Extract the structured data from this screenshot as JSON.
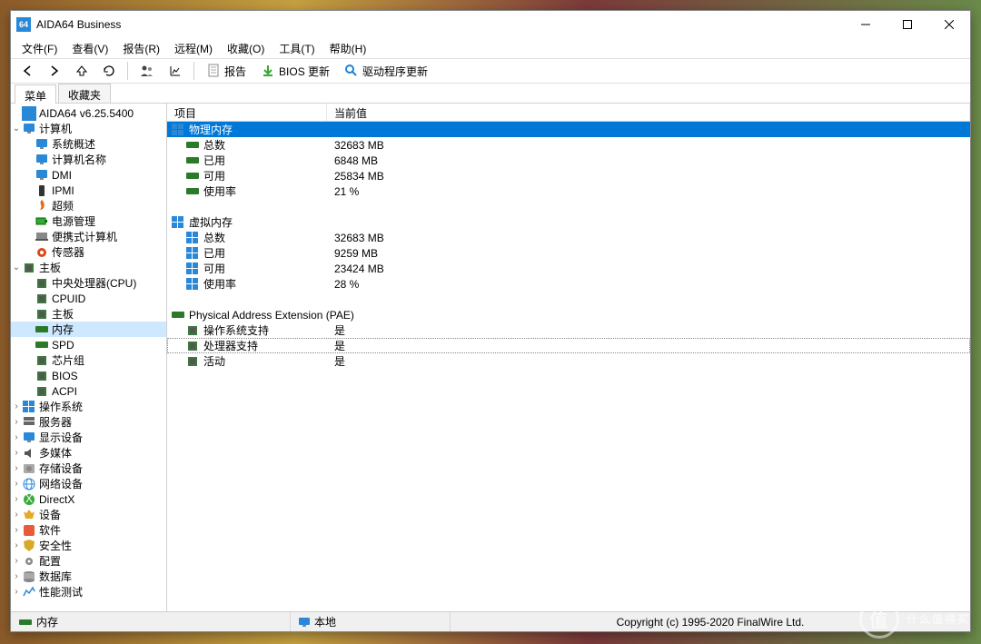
{
  "title": "AIDA64 Business",
  "menu": [
    "文件(F)",
    "查看(V)",
    "报告(R)",
    "远程(M)",
    "收藏(O)",
    "工具(T)",
    "帮助(H)"
  ],
  "toolbar": {
    "report": "报告",
    "bios": "BIOS 更新",
    "driver": "驱动程序更新"
  },
  "tabs": {
    "menu": "菜单",
    "fav": "收藏夹"
  },
  "tree": {
    "root": "AIDA64 v6.25.5400",
    "computer": "计算机",
    "computer_children": [
      "系统概述",
      "计算机名称",
      "DMI",
      "IPMI",
      "超频",
      "电源管理",
      "便携式计算机",
      "传感器"
    ],
    "mobo": "主板",
    "mobo_children": [
      "中央处理器(CPU)",
      "CPUID",
      "主板",
      "内存",
      "SPD",
      "芯片组",
      "BIOS",
      "ACPI"
    ],
    "rest": [
      "操作系统",
      "服务器",
      "显示设备",
      "多媒体",
      "存储设备",
      "网络设备",
      "DirectX",
      "设备",
      "软件",
      "安全性",
      "配置",
      "数据库",
      "性能测试"
    ]
  },
  "columns": {
    "item": "项目",
    "value": "当前值"
  },
  "sections": [
    {
      "name": "物理内存",
      "sel": true,
      "indent": 0.5,
      "rows": [
        [
          "总数",
          "32683 MB"
        ],
        [
          "已用",
          "6848 MB"
        ],
        [
          "可用",
          "25834 MB"
        ],
        [
          "使用率",
          "21 %"
        ]
      ]
    },
    {
      "name": "虚拟内存",
      "indent": 0.5,
      "rows": [
        [
          "总数",
          "32683 MB"
        ],
        [
          "已用",
          "9259 MB"
        ],
        [
          "可用",
          "23424 MB"
        ],
        [
          "使用率",
          "28 %"
        ]
      ]
    },
    {
      "name": "Physical Address Extension (PAE)",
      "indent": 0.5,
      "rows": [
        [
          "操作系统支持",
          "是"
        ],
        [
          "处理器支持",
          "是",
          "dotted"
        ],
        [
          "活动",
          "是"
        ]
      ]
    }
  ],
  "status": {
    "left": "内存",
    "mid": "本地",
    "copy": "Copyright (c) 1995-2020 FinalWire Ltd."
  },
  "watermark": "什么值得买"
}
